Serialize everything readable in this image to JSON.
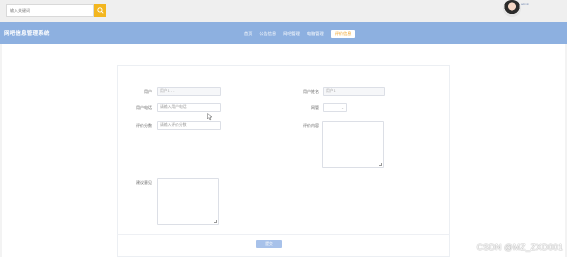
{
  "search": {
    "placeholder": "输入关键词"
  },
  "user": {
    "name": "admin"
  },
  "header": {
    "brand": "网吧信息管理系统",
    "nav": [
      {
        "label": "首页",
        "active": false
      },
      {
        "label": "公告信息",
        "active": false
      },
      {
        "label": "网吧管理",
        "active": false
      },
      {
        "label": "电脑管理",
        "active": false
      },
      {
        "label": "评价信息",
        "active": true
      }
    ]
  },
  "form": {
    "account_label": "用户",
    "account_value": "用户1 - -",
    "name_label": "用户姓名",
    "name_value": "用户1",
    "phone_label": "用户电话",
    "phone_placeholder": "请输入用户电话",
    "grade_label": "网管",
    "score_label": "评价分数",
    "score_placeholder": "请输入评价分数",
    "content_label": "评价内容",
    "suggest_label": "建议意见",
    "submit_label": "提交"
  },
  "watermark": "CSDN @MZ_ZXD001",
  "colors": {
    "header": "#8db0e0",
    "search_button": "#f3b61f",
    "active_nav_text": "#f0a020",
    "submit": "#a8c2ea"
  }
}
